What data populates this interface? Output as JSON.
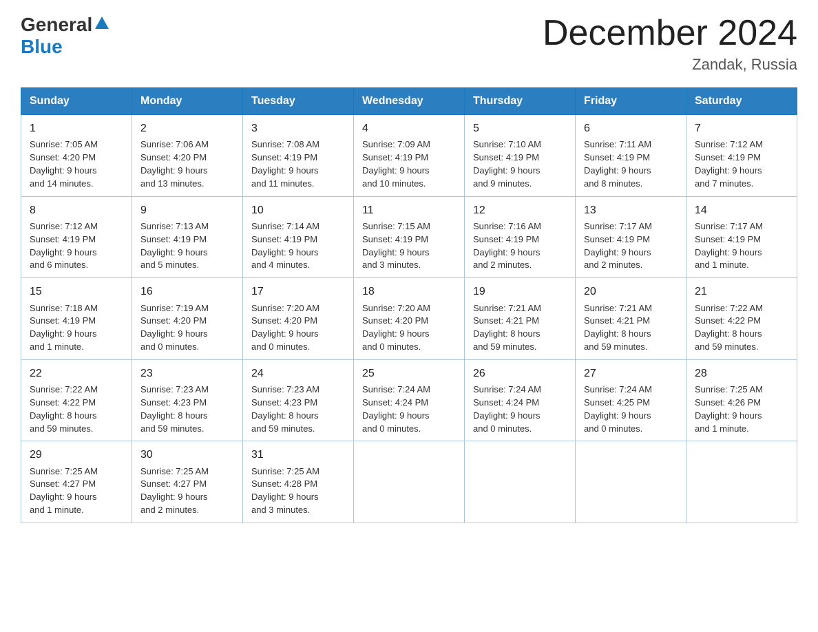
{
  "header": {
    "logo_general": "General",
    "logo_blue": "Blue",
    "month_title": "December 2024",
    "location": "Zandak, Russia"
  },
  "days_of_week": [
    "Sunday",
    "Monday",
    "Tuesday",
    "Wednesday",
    "Thursday",
    "Friday",
    "Saturday"
  ],
  "weeks": [
    [
      {
        "num": "1",
        "info": "Sunrise: 7:05 AM\nSunset: 4:20 PM\nDaylight: 9 hours\nand 14 minutes."
      },
      {
        "num": "2",
        "info": "Sunrise: 7:06 AM\nSunset: 4:20 PM\nDaylight: 9 hours\nand 13 minutes."
      },
      {
        "num": "3",
        "info": "Sunrise: 7:08 AM\nSunset: 4:19 PM\nDaylight: 9 hours\nand 11 minutes."
      },
      {
        "num": "4",
        "info": "Sunrise: 7:09 AM\nSunset: 4:19 PM\nDaylight: 9 hours\nand 10 minutes."
      },
      {
        "num": "5",
        "info": "Sunrise: 7:10 AM\nSunset: 4:19 PM\nDaylight: 9 hours\nand 9 minutes."
      },
      {
        "num": "6",
        "info": "Sunrise: 7:11 AM\nSunset: 4:19 PM\nDaylight: 9 hours\nand 8 minutes."
      },
      {
        "num": "7",
        "info": "Sunrise: 7:12 AM\nSunset: 4:19 PM\nDaylight: 9 hours\nand 7 minutes."
      }
    ],
    [
      {
        "num": "8",
        "info": "Sunrise: 7:12 AM\nSunset: 4:19 PM\nDaylight: 9 hours\nand 6 minutes."
      },
      {
        "num": "9",
        "info": "Sunrise: 7:13 AM\nSunset: 4:19 PM\nDaylight: 9 hours\nand 5 minutes."
      },
      {
        "num": "10",
        "info": "Sunrise: 7:14 AM\nSunset: 4:19 PM\nDaylight: 9 hours\nand 4 minutes."
      },
      {
        "num": "11",
        "info": "Sunrise: 7:15 AM\nSunset: 4:19 PM\nDaylight: 9 hours\nand 3 minutes."
      },
      {
        "num": "12",
        "info": "Sunrise: 7:16 AM\nSunset: 4:19 PM\nDaylight: 9 hours\nand 2 minutes."
      },
      {
        "num": "13",
        "info": "Sunrise: 7:17 AM\nSunset: 4:19 PM\nDaylight: 9 hours\nand 2 minutes."
      },
      {
        "num": "14",
        "info": "Sunrise: 7:17 AM\nSunset: 4:19 PM\nDaylight: 9 hours\nand 1 minute."
      }
    ],
    [
      {
        "num": "15",
        "info": "Sunrise: 7:18 AM\nSunset: 4:19 PM\nDaylight: 9 hours\nand 1 minute."
      },
      {
        "num": "16",
        "info": "Sunrise: 7:19 AM\nSunset: 4:20 PM\nDaylight: 9 hours\nand 0 minutes."
      },
      {
        "num": "17",
        "info": "Sunrise: 7:20 AM\nSunset: 4:20 PM\nDaylight: 9 hours\nand 0 minutes."
      },
      {
        "num": "18",
        "info": "Sunrise: 7:20 AM\nSunset: 4:20 PM\nDaylight: 9 hours\nand 0 minutes."
      },
      {
        "num": "19",
        "info": "Sunrise: 7:21 AM\nSunset: 4:21 PM\nDaylight: 8 hours\nand 59 minutes."
      },
      {
        "num": "20",
        "info": "Sunrise: 7:21 AM\nSunset: 4:21 PM\nDaylight: 8 hours\nand 59 minutes."
      },
      {
        "num": "21",
        "info": "Sunrise: 7:22 AM\nSunset: 4:22 PM\nDaylight: 8 hours\nand 59 minutes."
      }
    ],
    [
      {
        "num": "22",
        "info": "Sunrise: 7:22 AM\nSunset: 4:22 PM\nDaylight: 8 hours\nand 59 minutes."
      },
      {
        "num": "23",
        "info": "Sunrise: 7:23 AM\nSunset: 4:23 PM\nDaylight: 8 hours\nand 59 minutes."
      },
      {
        "num": "24",
        "info": "Sunrise: 7:23 AM\nSunset: 4:23 PM\nDaylight: 8 hours\nand 59 minutes."
      },
      {
        "num": "25",
        "info": "Sunrise: 7:24 AM\nSunset: 4:24 PM\nDaylight: 9 hours\nand 0 minutes."
      },
      {
        "num": "26",
        "info": "Sunrise: 7:24 AM\nSunset: 4:24 PM\nDaylight: 9 hours\nand 0 minutes."
      },
      {
        "num": "27",
        "info": "Sunrise: 7:24 AM\nSunset: 4:25 PM\nDaylight: 9 hours\nand 0 minutes."
      },
      {
        "num": "28",
        "info": "Sunrise: 7:25 AM\nSunset: 4:26 PM\nDaylight: 9 hours\nand 1 minute."
      }
    ],
    [
      {
        "num": "29",
        "info": "Sunrise: 7:25 AM\nSunset: 4:27 PM\nDaylight: 9 hours\nand 1 minute."
      },
      {
        "num": "30",
        "info": "Sunrise: 7:25 AM\nSunset: 4:27 PM\nDaylight: 9 hours\nand 2 minutes."
      },
      {
        "num": "31",
        "info": "Sunrise: 7:25 AM\nSunset: 4:28 PM\nDaylight: 9 hours\nand 3 minutes."
      },
      {
        "num": "",
        "info": ""
      },
      {
        "num": "",
        "info": ""
      },
      {
        "num": "",
        "info": ""
      },
      {
        "num": "",
        "info": ""
      }
    ]
  ]
}
